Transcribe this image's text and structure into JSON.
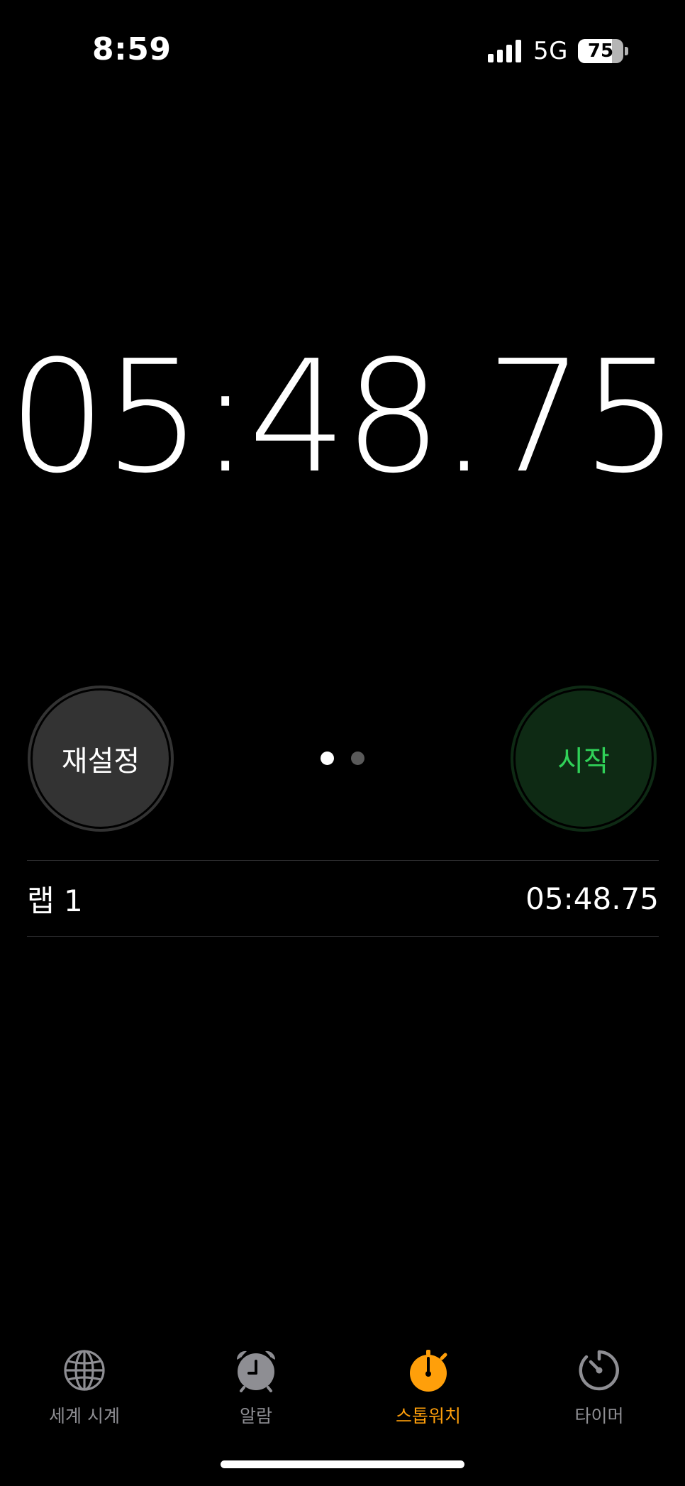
{
  "status_bar": {
    "time": "8:59",
    "network": "5G",
    "battery": "75",
    "battery_level": 0.75
  },
  "stopwatch": {
    "elapsed": "05:48.75"
  },
  "controls": {
    "reset_label": "재설정",
    "start_label": "시작",
    "page_count": 2,
    "active_page": 1
  },
  "laps": [
    {
      "label": "랩 1",
      "time": "05:48.75"
    }
  ],
  "tabs": [
    {
      "label": "세계 시계",
      "icon": "globe-icon",
      "active": false
    },
    {
      "label": "알람",
      "icon": "alarm-clock-icon",
      "active": false
    },
    {
      "label": "스톱워치",
      "icon": "stopwatch-icon",
      "active": true
    },
    {
      "label": "타이머",
      "icon": "timer-icon",
      "active": false
    }
  ],
  "colors": {
    "background": "#000000",
    "accent_active_tab": "#ff9f0a",
    "start_text": "#30d158",
    "start_bg": "#0e2a14",
    "reset_bg": "#333333",
    "inactive_tab": "#8e8e93"
  }
}
